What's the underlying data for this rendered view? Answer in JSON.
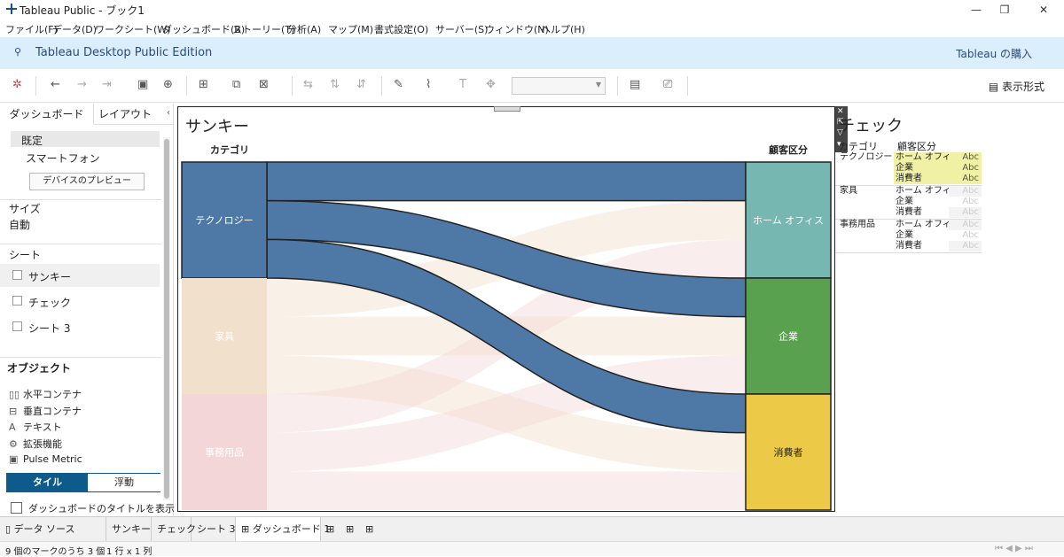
{
  "window": {
    "title": "Tableau Public - ブック1"
  },
  "menu": [
    "ファイル(F)",
    "データ(D)",
    "ワークシート(W)",
    "ダッシュボード(B)",
    "ストーリー(T)",
    "分析(A)",
    "マップ(M)",
    "書式設定(O)",
    "サーバー(S)",
    "ウィンドウ(N)",
    "ヘルプ(H)"
  ],
  "brand": {
    "name": "Tableau Desktop Public Edition",
    "buy": "Tableau の購入"
  },
  "toolbar": {
    "show_me": "表示形式"
  },
  "left_panel": {
    "tab_dashboard": "ダッシュボード",
    "tab_layout": "レイアウト",
    "device_default": "既定",
    "device_phone": "スマートフォン",
    "device_preview": "デバイスのプレビュー",
    "size_label": "サイズ",
    "size_value": "自動",
    "sheets_label": "シート",
    "sheets": [
      "サンキー",
      "チェック",
      "シート 3"
    ],
    "objects_label": "オブジェクト",
    "objects": [
      {
        "icon": "horizontal-container-icon",
        "glyph": "▯▯",
        "label": "水平コンテナ"
      },
      {
        "icon": "vertical-container-icon",
        "glyph": "⊟",
        "label": "垂直コンテナ"
      },
      {
        "icon": "text-icon",
        "glyph": "A",
        "label": "テキスト"
      },
      {
        "icon": "extension-icon",
        "glyph": "⚙",
        "label": "拡張機能"
      },
      {
        "icon": "pulse-metric-icon",
        "glyph": "▣",
        "label": "Pulse Metric"
      }
    ],
    "tile": "タイル",
    "float": "浮動",
    "show_title": "ダッシュボードのタイトルを表示"
  },
  "dashboard": {
    "title": "サンキー",
    "left_header": "カテゴリ",
    "right_header": "顧客区分"
  },
  "chart_data": {
    "type": "sankey",
    "source_nodes": [
      {
        "name": "テクノロジー",
        "color": "#4e79a7"
      },
      {
        "name": "家具",
        "color": "#f1e0cc"
      },
      {
        "name": "事務用品",
        "color": "#f3d7d8"
      }
    ],
    "target_nodes": [
      {
        "name": "ホーム オフィス",
        "color": "#76b7b2"
      },
      {
        "name": "企業",
        "color": "#59a14f"
      },
      {
        "name": "消費者",
        "color": "#edc948"
      }
    ],
    "highlighted_source": "テクノロジー"
  },
  "check_sheet": {
    "title": "チェック",
    "col_category": "カテゴリ",
    "col_segment": "顧客区分",
    "rows": [
      {
        "category": "テクノロジー",
        "segments": [
          "ホーム オフィス",
          "企業",
          "消費者"
        ],
        "highlight": true
      },
      {
        "category": "家具",
        "segments": [
          "ホーム オフィス",
          "企業",
          "消費者"
        ],
        "highlight": false
      },
      {
        "category": "事務用品",
        "segments": [
          "ホーム オフィス",
          "企業",
          "消費者"
        ],
        "highlight": false
      }
    ],
    "cell": "Abc"
  },
  "bottom_tabs": {
    "data_source": "データ ソース",
    "sheets": [
      "サンキー",
      "チェック",
      "シート 3"
    ],
    "dashboard": "ダッシュボード 1"
  },
  "status": {
    "marks": "9 個のマークのうち 3 個",
    "rows_cols": "1 行 x 1 列"
  }
}
